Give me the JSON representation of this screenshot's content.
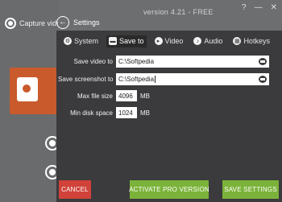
{
  "window": {
    "version": "version 4.21 - FREE",
    "controls": [
      "?",
      "—",
      "✕"
    ]
  },
  "background": {
    "capture_label": "Capture video"
  },
  "settings": {
    "title": "Settings",
    "tabs": [
      {
        "label": "System",
        "icon": "gear-icon",
        "active": false
      },
      {
        "label": "Save to",
        "icon": "folder-icon",
        "active": true
      },
      {
        "label": "Video",
        "icon": "video-icon",
        "active": false
      },
      {
        "label": "Audio",
        "icon": "audio-icon",
        "active": false
      },
      {
        "label": "Hotkeys",
        "icon": "keyboard-icon",
        "active": false
      }
    ],
    "fields": {
      "save_video": {
        "label": "Save video to",
        "value": "C:\\Softpedia"
      },
      "save_screenshot": {
        "label": "Save screenshot to",
        "value": "C:\\Softpedia"
      },
      "max_file_size": {
        "label": "Max file size",
        "value": "4096",
        "unit": "MB"
      },
      "min_disk_space": {
        "label": "Min disk space",
        "value": "1024",
        "unit": "MB"
      }
    }
  },
  "footer": {
    "cancel": "CANCEL",
    "activate": "ACTIVATE PRO VERSION",
    "save": "SAVE SETTINGS"
  },
  "colors": {
    "panel": "#3b3b3d",
    "cancel": "#d0423a",
    "accent_green": "#7bb33a",
    "brand_orange": "#c95a2c"
  }
}
